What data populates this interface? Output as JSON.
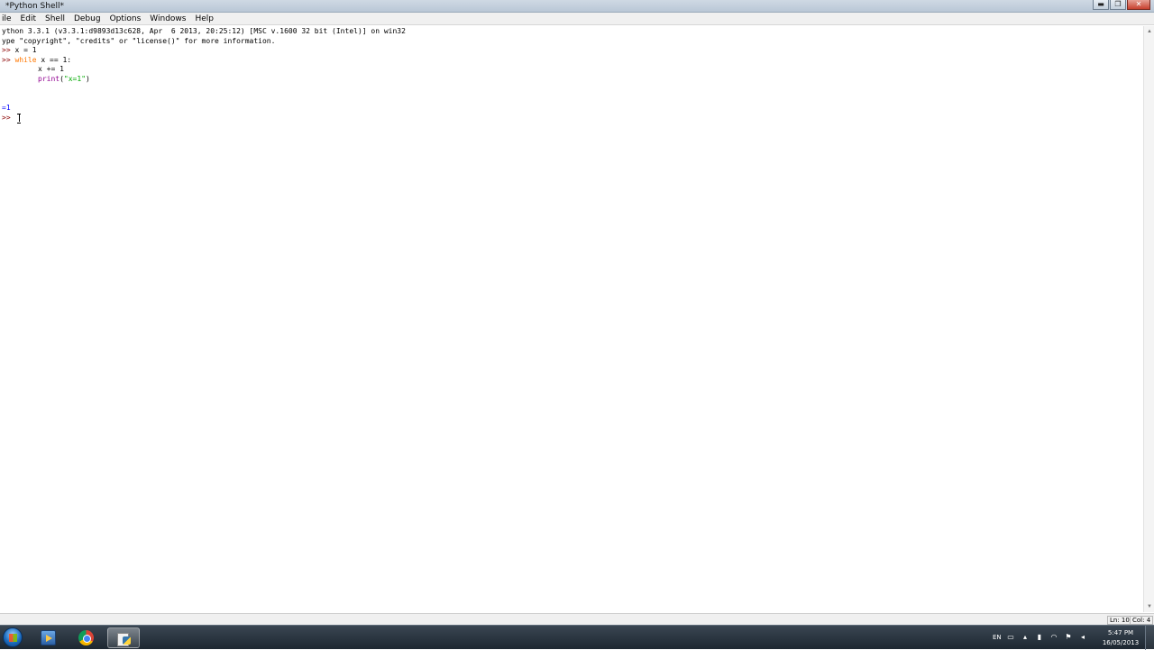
{
  "window": {
    "title": "*Python Shell*",
    "controls": {
      "minimize": "▬",
      "maximize": "❐",
      "close": "✕"
    }
  },
  "menu": {
    "items": [
      "ile",
      "Edit",
      "Shell",
      "Debug",
      "Options",
      "Windows",
      "Help"
    ]
  },
  "editor": {
    "lines": [
      {
        "type": "text",
        "text": "ython 3.3.1 (v3.3.1:d9893d13c628, Apr  6 2013, 20:25:12) [MSC v.1600 32 bit (Intel)] on win32"
      },
      {
        "type": "text",
        "text": "ype \"copyright\", \"credits\" or \"license()\" for more information."
      },
      {
        "type": "prompt",
        "prompt": ">> ",
        "code": "x = 1"
      },
      {
        "type": "while",
        "prompt": ">> ",
        "keyword": "while",
        "code": " x == 1:"
      },
      {
        "type": "indent",
        "code": "x += 1"
      },
      {
        "type": "print",
        "builtin": "print",
        "open": "(",
        "string": "\"x=1\"",
        "close": ")"
      },
      {
        "type": "blank"
      },
      {
        "type": "blank"
      },
      {
        "type": "output",
        "text": "=1"
      },
      {
        "type": "prompt",
        "prompt": ">> ",
        "code": ""
      }
    ]
  },
  "statusbar": {
    "line": "Ln: 10",
    "col": "Col: 4"
  },
  "taskbar": {
    "apps": [
      {
        "name": "windows-media-player",
        "active": false
      },
      {
        "name": "google-chrome",
        "active": false
      },
      {
        "name": "python-idle",
        "active": true
      }
    ],
    "tray": {
      "language": "EN",
      "time": "5:47 PM",
      "date": "16/05/2013"
    }
  },
  "colors": {
    "keyword": "#ff7700",
    "builtin": "#900090",
    "string": "#00aa00",
    "output": "#0000ff",
    "prompt": "#8b0000"
  }
}
